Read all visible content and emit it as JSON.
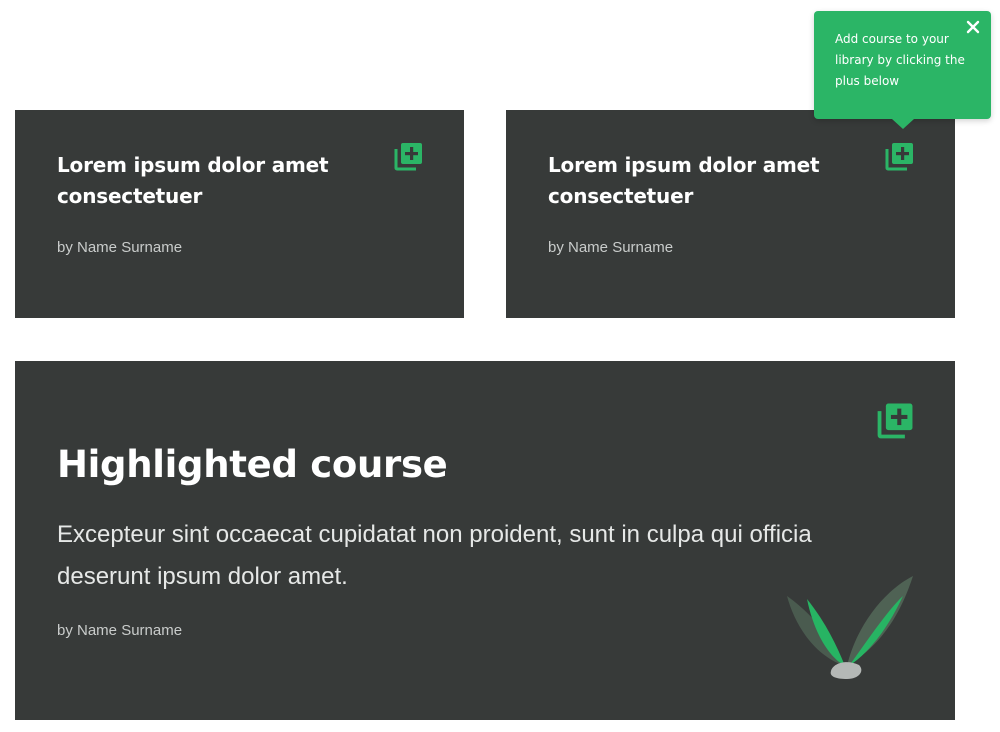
{
  "cards": [
    {
      "title": "Lorem ipsum dolor amet consectetuer",
      "author": "by Name Surname",
      "add_icon": "add-to-library-icon"
    },
    {
      "title": "Lorem ipsum dolor amet consectetuer",
      "author": "by Name Surname",
      "add_icon": "add-to-library-icon"
    }
  ],
  "highlight": {
    "title": "Highlighted course",
    "description": "Excepteur sint occaecat cupidatat non proident, sunt in culpa qui officia deserunt ipsum dolor amet.",
    "author": "by Name Surname",
    "add_icon": "add-to-library-icon",
    "illustration": "plant-leaves-icon"
  },
  "tooltip": {
    "text": "Add course to your library by clicking the plus below",
    "close_icon": "close-icon"
  },
  "colors": {
    "card_background": "#373a39",
    "accent_green": "#2bb566",
    "page_background": "#ffffff"
  }
}
